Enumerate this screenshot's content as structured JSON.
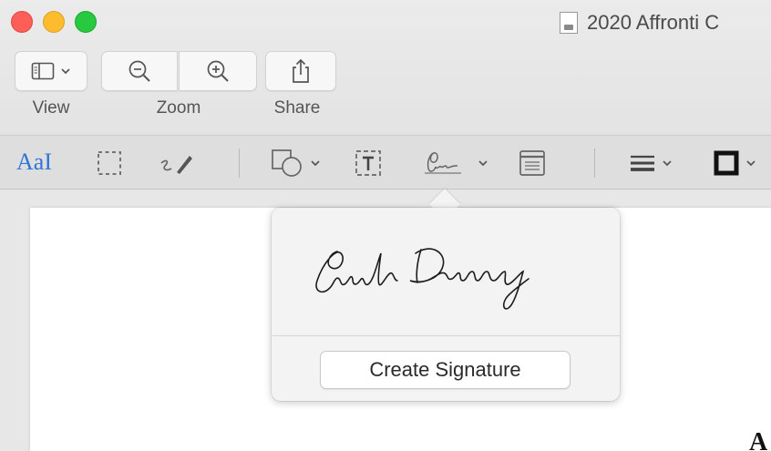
{
  "window": {
    "title": "2020 Affronti C",
    "traffic_lights": {
      "close": "#fc5f57",
      "minimize": "#fdbc2e",
      "zoom": "#28c840"
    }
  },
  "toolbar": {
    "view_label": "View",
    "zoom_label": "Zoom",
    "share_label": "Share",
    "icons": [
      "sidebar-icon",
      "chevron-down-icon",
      "zoom-out-icon",
      "zoom-in-icon",
      "share-icon"
    ]
  },
  "markup_toolbar": {
    "text_select_label": "AaI",
    "accent_color": "#2f76d8",
    "tools": [
      "text-select-tool",
      "rectangular-selection-tool",
      "sketch-tool",
      "shapes-tool",
      "text-box-tool",
      "sign-tool",
      "note-tool",
      "shape-style-tool",
      "border-color-tool"
    ]
  },
  "signature_popover": {
    "signature_name": "Sarah Denney",
    "create_button_label": "Create Signature"
  },
  "document": {
    "visible_glyph": "A"
  }
}
